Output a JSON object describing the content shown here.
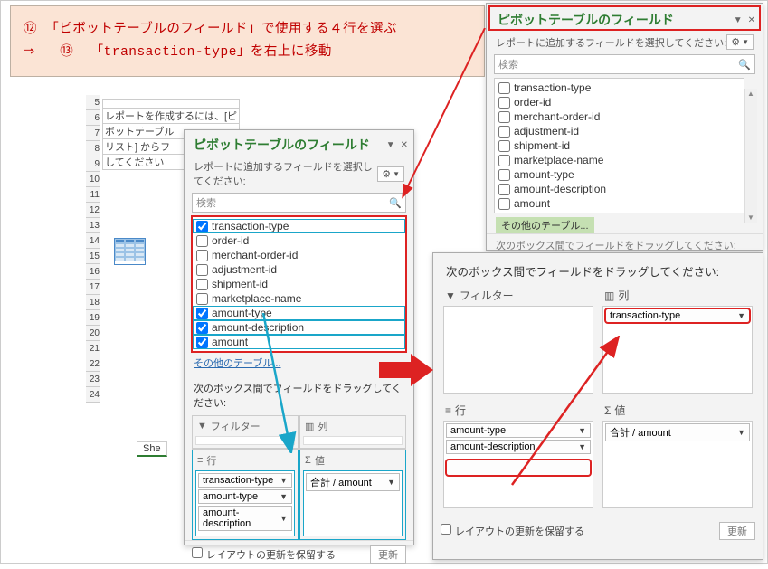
{
  "instruction": {
    "num1": "⑫",
    "line1": "「ピボットテーブルのフィールド」で使用する４行を選ぶ",
    "arrow": "⇒",
    "num2": "⑬",
    "line2": "「transaction-type」を右上に移動"
  },
  "sheet": {
    "text1": "レポートを作成するには、[ピ",
    "text2": "ボットテーブル",
    "text3": "リスト] からフ",
    "text4": "してください",
    "rows": [
      "5",
      "6",
      "7",
      "8",
      "9",
      "10",
      "11",
      "12",
      "13",
      "14",
      "15",
      "16",
      "17",
      "18",
      "19",
      "20",
      "21",
      "22",
      "23",
      "24"
    ],
    "tab": "She"
  },
  "panel": {
    "title": "ピボットテーブルのフィールド",
    "sub": "レポートに追加するフィールドを選択してください:",
    "search_ph": "検索",
    "other": "その他のテーブル...",
    "drag_hint": "次のボックス間でフィールドをドラッグしてください:",
    "q_filter": "フィルター",
    "q_cols": "列",
    "q_rows": "行",
    "q_vals": "値",
    "defer": "レイアウトの更新を保留する",
    "update": "更新"
  },
  "fields_mid": [
    {
      "name": "transaction-type",
      "checked": true,
      "sel": true
    },
    {
      "name": "order-id",
      "checked": false,
      "sel": false
    },
    {
      "name": "merchant-order-id",
      "checked": false,
      "sel": false
    },
    {
      "name": "adjustment-id",
      "checked": false,
      "sel": false
    },
    {
      "name": "shipment-id",
      "checked": false,
      "sel": false
    },
    {
      "name": "marketplace-name",
      "checked": false,
      "sel": false
    },
    {
      "name": "amount-type",
      "checked": true,
      "sel": true
    },
    {
      "name": "amount-description",
      "checked": true,
      "sel": true
    },
    {
      "name": "amount",
      "checked": true,
      "sel": true
    }
  ],
  "fields_top": [
    {
      "name": "transaction-type"
    },
    {
      "name": "order-id"
    },
    {
      "name": "merchant-order-id"
    },
    {
      "name": "adjustment-id"
    },
    {
      "name": "shipment-id"
    },
    {
      "name": "marketplace-name"
    },
    {
      "name": "amount-type"
    },
    {
      "name": "amount-description"
    },
    {
      "name": "amount"
    }
  ],
  "mid_rows_chips": [
    "transaction-type",
    "amount-type",
    "amount-description"
  ],
  "mid_vals_chips": [
    "合計 / amount"
  ],
  "big_rows_chips": [
    "amount-type",
    "amount-description"
  ],
  "big_cols_chips": [
    "transaction-type"
  ],
  "big_vals_chips": [
    "合計 / amount"
  ],
  "top_cut": "次のボックス間でフィールドをドラッグしてください:"
}
